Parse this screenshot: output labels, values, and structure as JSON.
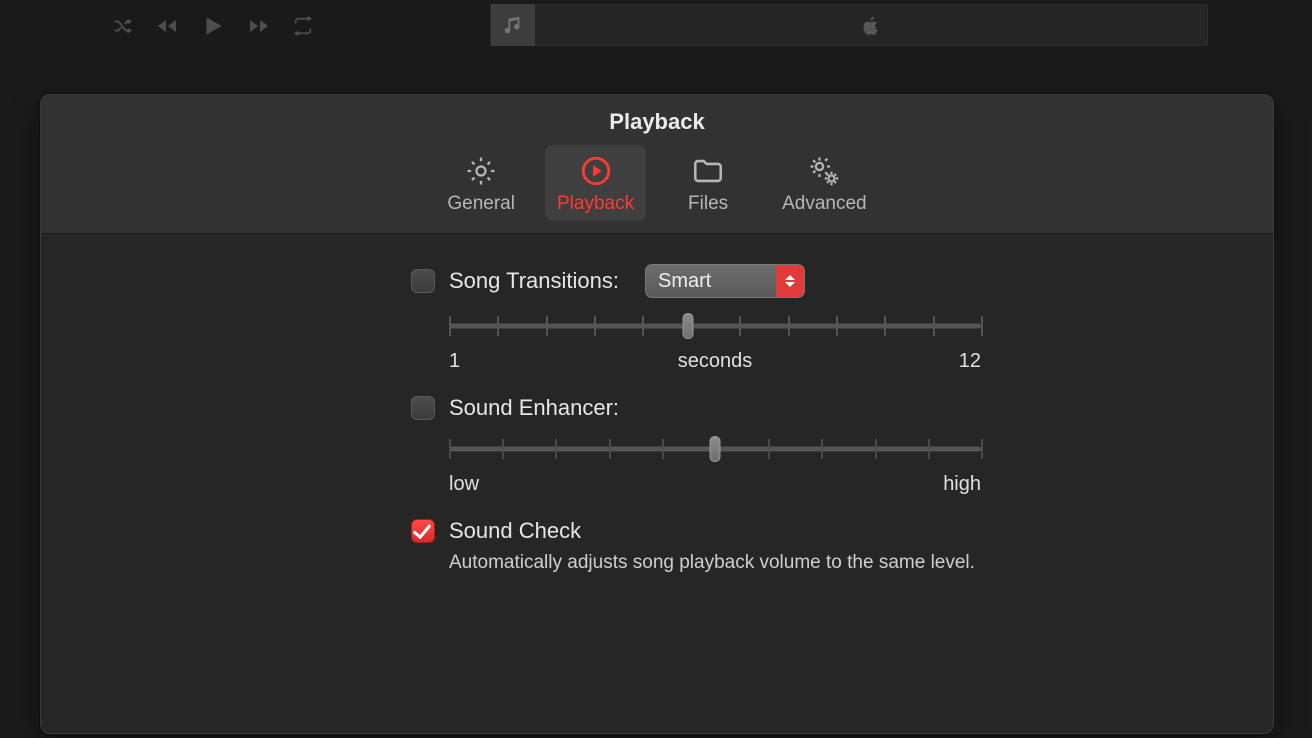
{
  "window": {
    "title": "Playback"
  },
  "tabs": [
    {
      "label": "General"
    },
    {
      "label": "Playback"
    },
    {
      "label": "Files"
    },
    {
      "label": "Advanced"
    }
  ],
  "songTransitions": {
    "label": "Song Transitions:",
    "selectValue": "Smart",
    "slider": {
      "min": "1",
      "max": "12",
      "unit": "seconds",
      "position": 0.45
    }
  },
  "soundEnhancer": {
    "label": "Sound Enhancer:",
    "slider": {
      "low": "low",
      "high": "high",
      "position": 0.5
    }
  },
  "soundCheck": {
    "label": "Sound Check",
    "description": "Automatically adjusts song playback volume to the same level."
  }
}
